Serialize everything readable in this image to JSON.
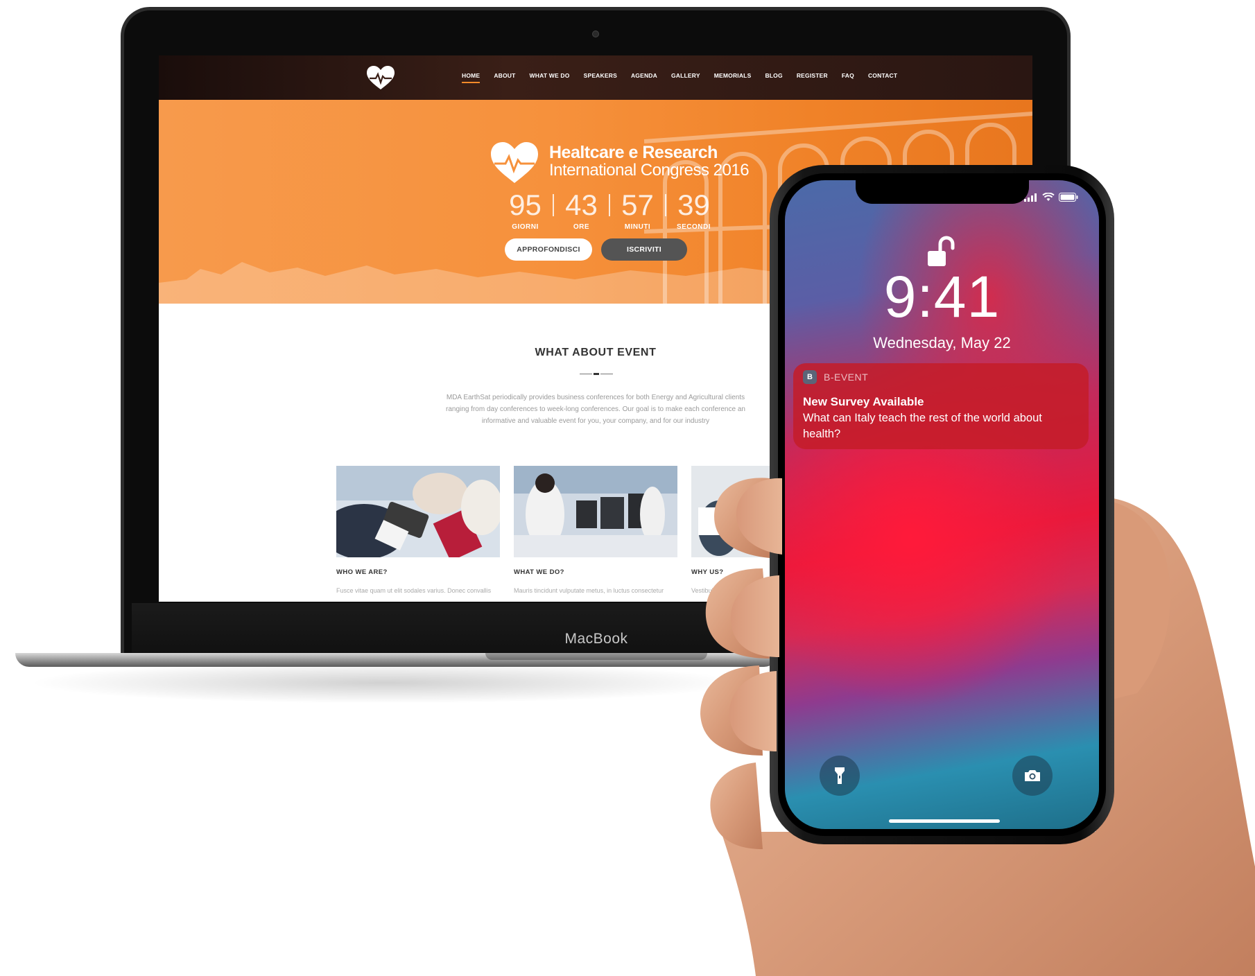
{
  "laptop": {
    "brand": "MacBook"
  },
  "website": {
    "nav": {
      "items": [
        "HOME",
        "ABOUT",
        "WHAT WE DO",
        "SPEAKERS",
        "AGENDA",
        "GALLERY",
        "MEMORIALS",
        "BLOG",
        "REGISTER",
        "FAQ",
        "CONTACT"
      ],
      "active": "HOME"
    },
    "hero": {
      "title_line1": "Healtcare e Research",
      "title_line2": "International Congress 2016",
      "countdown": [
        {
          "value": "95",
          "label": "GIORNI"
        },
        {
          "value": "43",
          "label": "ORE"
        },
        {
          "value": "57",
          "label": "MINUTI"
        },
        {
          "value": "39",
          "label": "SECONDI"
        }
      ],
      "btn_primary": "APPROFONDISCI",
      "btn_secondary": "ISCRIVITI",
      "accent_color": "#f6913c"
    },
    "about": {
      "title": "WHAT ABOUT EVENT",
      "text_lines": [
        "MDA EarthSat periodically provides business conferences for both Energy and Agricultural clients",
        "ranging from day conferences to week-long conferences. Our goal is to make each conference an",
        "informative and valuable event for you, your company, and for our industry"
      ]
    },
    "cards": [
      {
        "title": "WHO WE ARE?",
        "text": "Fusce vitae quam ut elit sodales varius. Donec convallis"
      },
      {
        "title": "WHAT WE DO?",
        "text": "Mauris tincidunt vulputate metus, in luctus consectetur"
      },
      {
        "title": "WHY US?",
        "text": "Vestibulum"
      }
    ]
  },
  "phone": {
    "time": "9:41",
    "date": "Wednesday, May 22",
    "notification": {
      "app_icon_letter": "B",
      "app_name": "B-EVENT",
      "title": "New Survey Available",
      "body": "What can Italy teach the rest of the world about health?"
    },
    "quick_actions": [
      "flashlight-icon",
      "camera-icon"
    ]
  }
}
